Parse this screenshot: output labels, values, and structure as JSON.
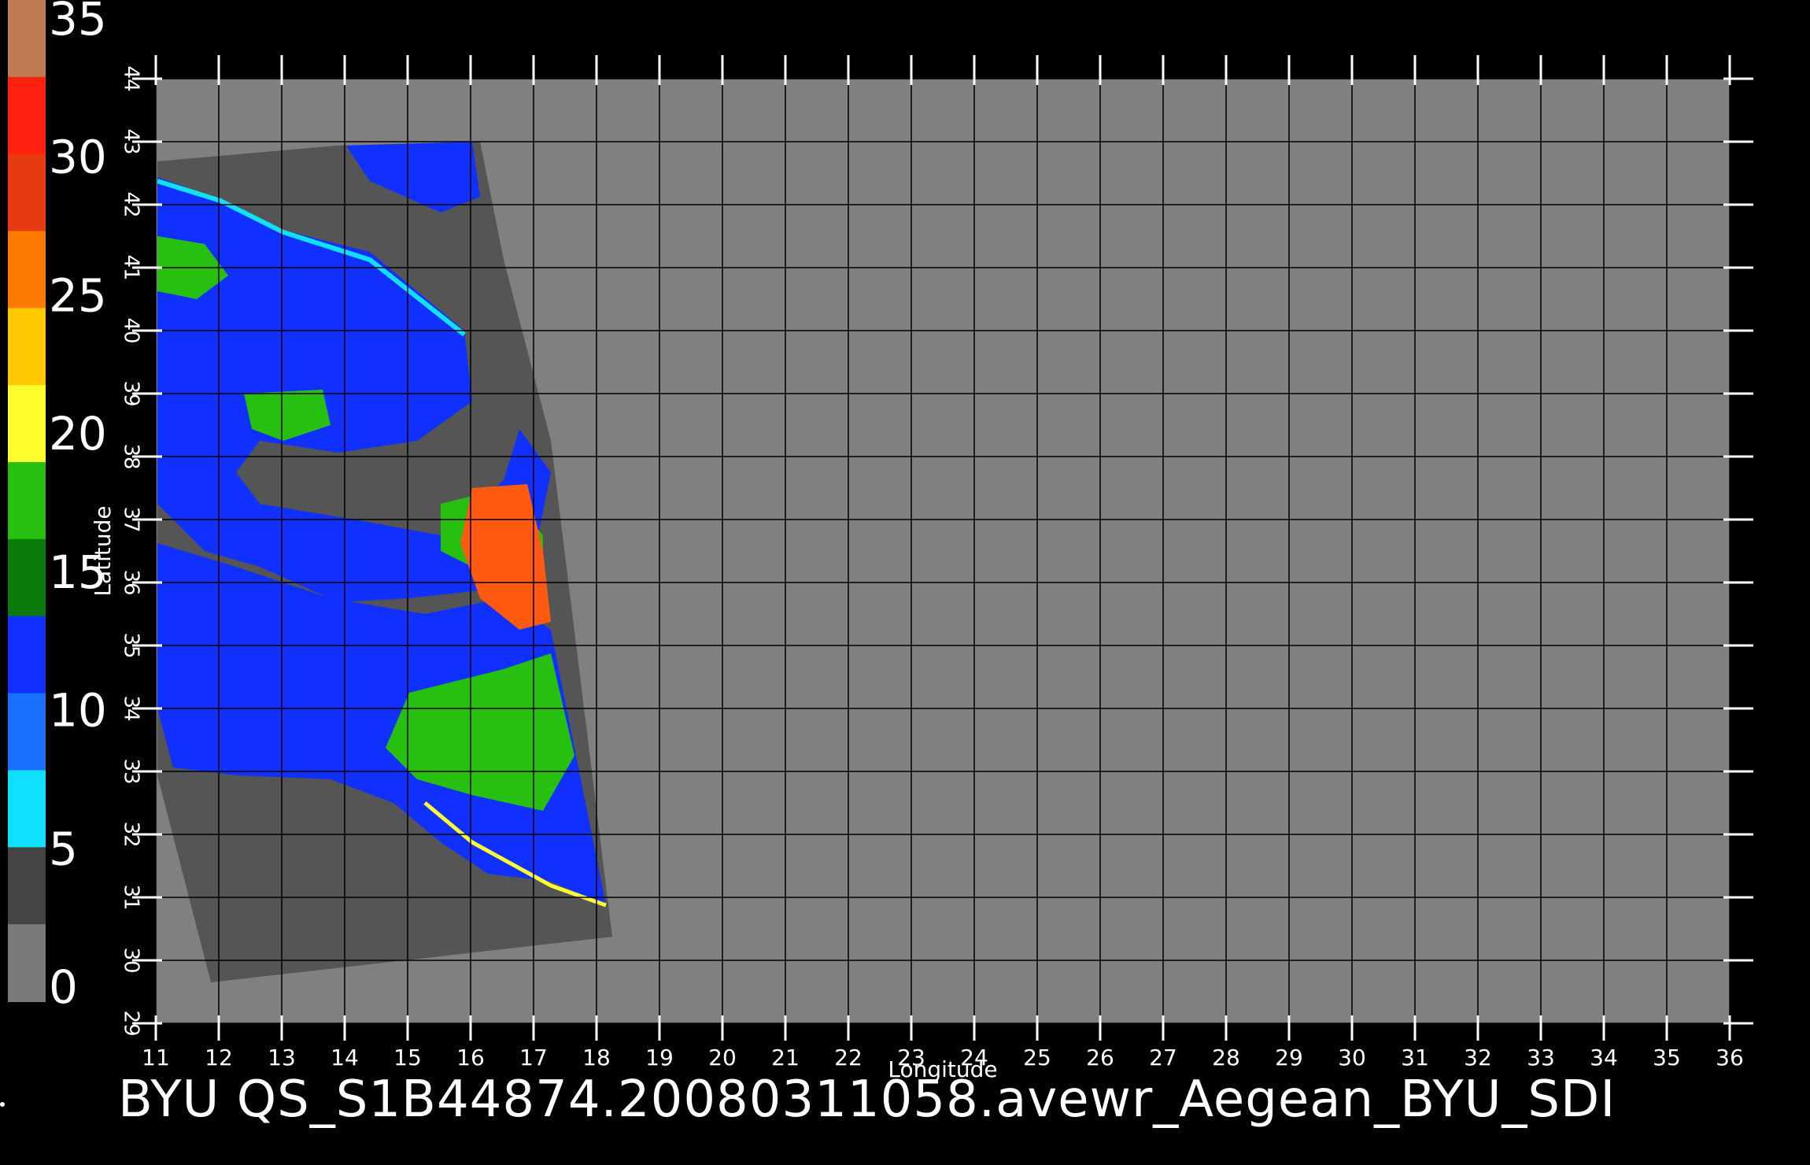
{
  "title": "BYU  QS_S1B44874.200803110 58.avewr_Aegean_BYU_SDI",
  "title_text": "BYU  QS_S1B44874.20080311058.avewr_Aegean_BYU_SDI",
  "axes": {
    "x_label": "Longitude",
    "y_label": "Latitude",
    "x_ticks": [
      "11",
      "12",
      "13",
      "14",
      "15",
      "16",
      "17",
      "18",
      "19",
      "20",
      "21",
      "22",
      "23",
      "24",
      "25",
      "26",
      "27",
      "28",
      "29",
      "30",
      "31",
      "32",
      "33",
      "34",
      "35",
      "36"
    ],
    "y_ticks": [
      "29",
      "30",
      "31",
      "32",
      "33",
      "34",
      "35",
      "36",
      "37",
      "38",
      "39",
      "40",
      "41",
      "42",
      "43",
      "44"
    ]
  },
  "colorbar": {
    "labels": [
      "35",
      "30",
      "25",
      "20",
      "15",
      "10",
      "5",
      "0"
    ],
    "segments": [
      {
        "color": "#c07a52"
      },
      {
        "color": "#ff2010"
      },
      {
        "color": "#e83a10"
      },
      {
        "color": "#ff7a00"
      },
      {
        "color": "#ffc800"
      },
      {
        "color": "#ffff30"
      },
      {
        "color": "#28c010"
      },
      {
        "color": "#0a7a0a"
      },
      {
        "color": "#1030ff"
      },
      {
        "color": "#1a70ff"
      },
      {
        "color": "#10e0ff"
      },
      {
        "color": "#444444"
      },
      {
        "color": "#7a7a7a"
      }
    ]
  },
  "colors": {
    "background": "#000000",
    "plot_fill": "#808080",
    "swath_fill": "#555555",
    "grid": "#000000",
    "axis": "#ffffff",
    "ocean_low": "#1030ff",
    "ocean_mid": "#28c010",
    "ocean_high": "#ff5a10",
    "coast_cyan": "#10e0ff",
    "coast_yellow": "#ffff30"
  }
}
